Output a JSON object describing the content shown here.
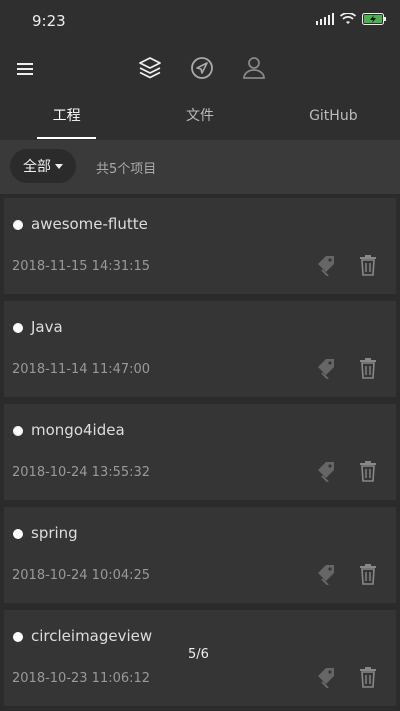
{
  "status": {
    "time": "9:23"
  },
  "tabs": [
    {
      "label": "工程",
      "active": true
    },
    {
      "label": "文件",
      "active": false
    },
    {
      "label": "GitHub",
      "active": false
    }
  ],
  "filter": {
    "selected": "全部",
    "count_text": "共5个项目"
  },
  "projects": [
    {
      "name": "awesome-flutte",
      "date": "2018-11-15 14:31:15"
    },
    {
      "name": "Java",
      "date": "2018-11-14 11:47:00"
    },
    {
      "name": "mongo4idea",
      "date": "2018-10-24 13:55:32"
    },
    {
      "name": "spring",
      "date": "2018-10-24 10:04:25"
    },
    {
      "name": "circleimageview",
      "date": "2018-10-23 11:06:12"
    }
  ],
  "pager": "5/6",
  "colors": {
    "background": "#2b2b2b",
    "card": "#353535",
    "battery": "#4caf50"
  },
  "icons": [
    "menu-icon",
    "layers-icon",
    "navigation-icon",
    "user-icon",
    "tag-icon",
    "trash-icon"
  ]
}
